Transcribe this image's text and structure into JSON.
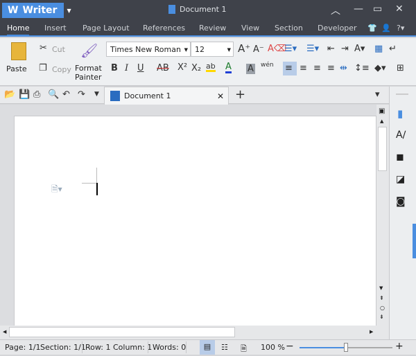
{
  "app": {
    "name": "Writer",
    "document_title": "Document 1"
  },
  "menu": {
    "tabs": [
      "Home",
      "Insert",
      "Page Layout",
      "References",
      "Review",
      "View",
      "Section",
      "Developer"
    ],
    "active": "Home"
  },
  "ribbon": {
    "paste": "Paste",
    "cut": "Cut",
    "copy": "Copy",
    "format_painter_line1": "Format",
    "format_painter_line2": "Painter",
    "font": "Times New Roman",
    "size": "12",
    "bold": "B",
    "italic": "I",
    "underline": "U",
    "strikethrough": "AB",
    "superscript": "X²",
    "subscript": "X₂",
    "font_color": "A",
    "char_shading": "A",
    "phonetic": "wén"
  },
  "tabs": {
    "doc_tab": "Document 1"
  },
  "status": {
    "page": "Page: 1/1",
    "section": "Section: 1/1",
    "row_col": "Row: 1 Column: 1",
    "words": "Words: 0",
    "zoom": "100 %",
    "zoom_percent": 100
  },
  "colors": {
    "accent": "#4a8ee0",
    "titlebar": "#3f424a",
    "highlight": "#ffd800",
    "font_color": "#1f3fd6"
  }
}
